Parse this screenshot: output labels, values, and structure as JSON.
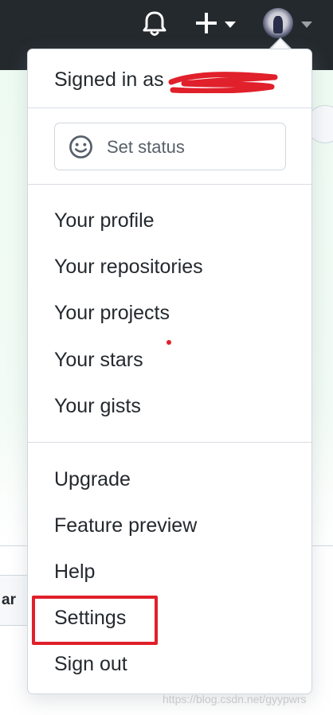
{
  "header": {
    "icons": [
      "bell-icon",
      "plus-icon",
      "caret-down-icon",
      "avatar",
      "caret-down-icon"
    ]
  },
  "background": {
    "tab_fragment": "ar"
  },
  "dropdown": {
    "signed_in_text": "Signed in as",
    "set_status_label": "Set status",
    "section1": [
      "Your profile",
      "Your repositories",
      "Your projects",
      "Your stars",
      "Your gists"
    ],
    "section2": [
      "Upgrade",
      "Feature preview",
      "Help",
      "Settings",
      "Sign out"
    ],
    "highlighted_item": "Settings"
  },
  "colors": {
    "header_bg": "#24292e",
    "highlight": "#e0202a",
    "text": "#24292e"
  },
  "watermark": "https://blog.csdn.net/gyypwrs"
}
